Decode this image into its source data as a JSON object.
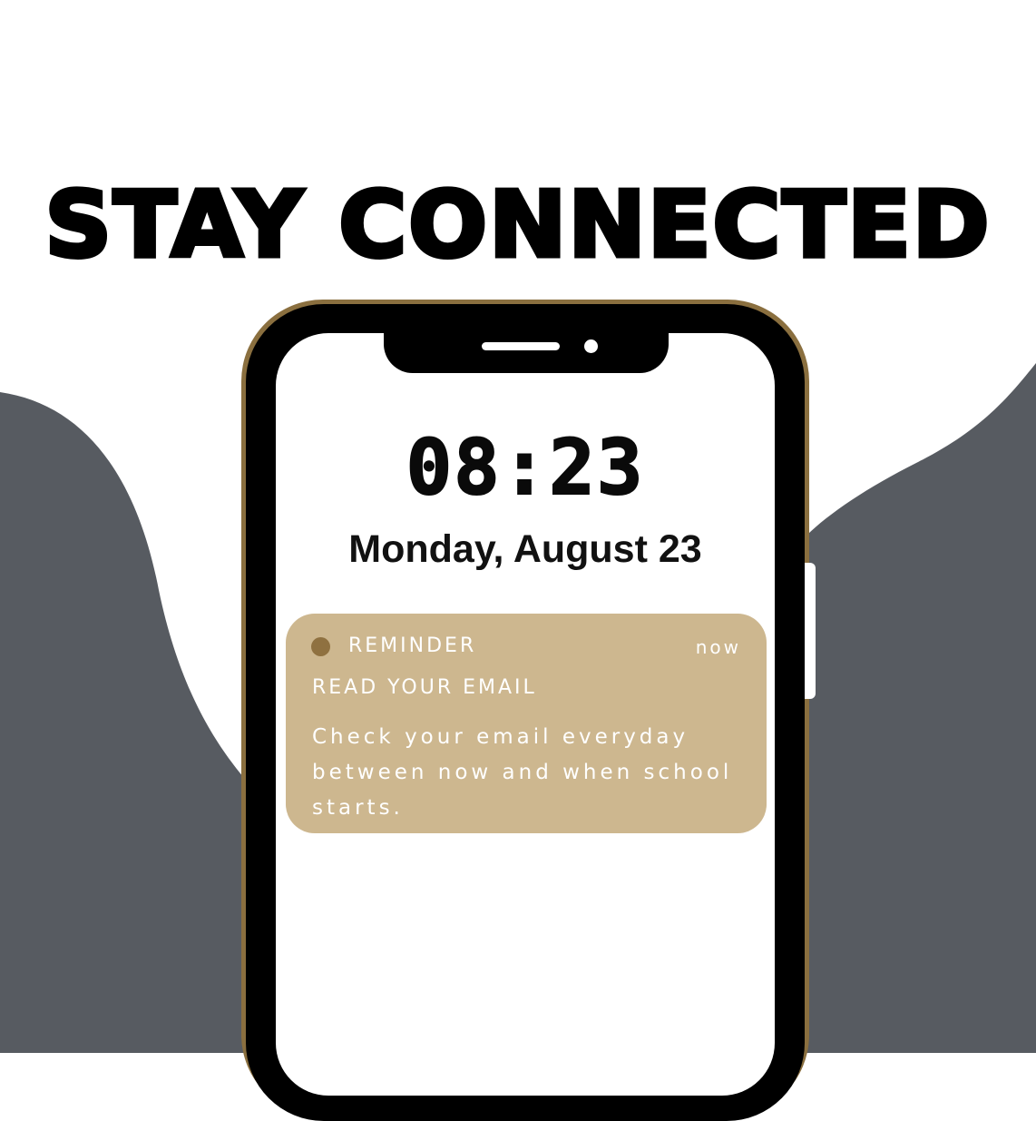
{
  "poster": {
    "headline": "STAY CONNECTED",
    "colors": {
      "background": "#ffffff",
      "gray_shape": "#575b61",
      "gold": "#8a6f3f",
      "notification_tan": "#cdb78f",
      "phone_black": "#000000"
    }
  },
  "lock_screen": {
    "time": "08:23",
    "date": "Monday, August 23",
    "notification": {
      "app_icon": "gold-dot-icon",
      "app_name": "REMINDER",
      "timestamp": "now",
      "title": "READ YOUR EMAIL",
      "body": "Check your email everyday between now and when school starts."
    }
  }
}
